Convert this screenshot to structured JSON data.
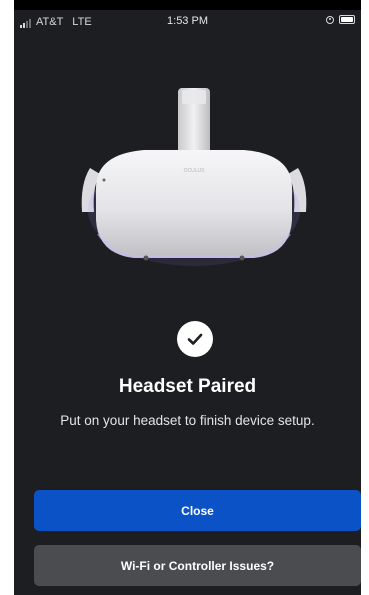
{
  "status_bar": {
    "carrier": "AT&T",
    "network": "LTE",
    "time": "1:53 PM"
  },
  "headset": {
    "brand_text": "OCULUS"
  },
  "content": {
    "title": "Headset Paired",
    "subtitle": "Put on your headset to finish device setup."
  },
  "buttons": {
    "close_label": "Close",
    "issues_label": "Wi-Fi or Controller Issues?"
  },
  "colors": {
    "background": "#1c1e21",
    "primary_button": "#0b52c7",
    "secondary_button": "#4a4c50",
    "text": "#ffffff"
  },
  "icons": {
    "status": [
      "signal-icon",
      "orientation-lock-icon",
      "battery-icon"
    ],
    "confirmation": "checkmark-icon"
  }
}
